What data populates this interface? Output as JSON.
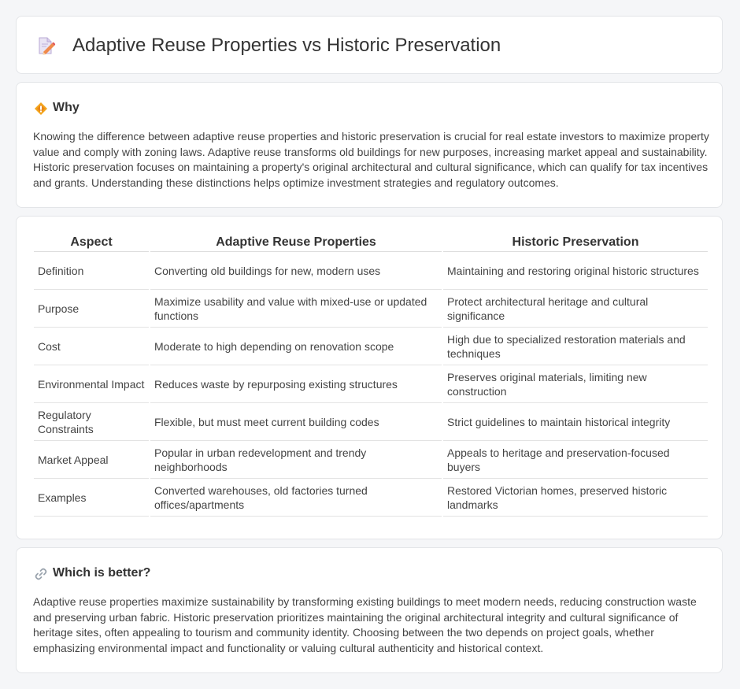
{
  "header": {
    "title": "Adaptive Reuse Properties vs Historic Preservation",
    "icon": "document-pencil-icon"
  },
  "why": {
    "heading": "Why",
    "icon": "diamond-warning-icon",
    "text": "Knowing the difference between adaptive reuse properties and historic preservation is crucial for real estate investors to maximize property value and comply with zoning laws. Adaptive reuse transforms old buildings for new purposes, increasing market appeal and sustainability. Historic preservation focuses on maintaining a property's original architectural and cultural significance, which can qualify for tax incentives and grants. Understanding these distinctions helps optimize investment strategies and regulatory outcomes."
  },
  "table": {
    "headers": [
      "Aspect",
      "Adaptive Reuse Properties",
      "Historic Preservation"
    ],
    "rows": [
      [
        "Definition",
        "Converting old buildings for new, modern uses",
        "Maintaining and restoring original historic structures"
      ],
      [
        "Purpose",
        "Maximize usability and value with mixed-use or updated functions",
        "Protect architectural heritage and cultural significance"
      ],
      [
        "Cost",
        "Moderate to high depending on renovation scope",
        "High due to specialized restoration materials and techniques"
      ],
      [
        "Environmental Impact",
        "Reduces waste by repurposing existing structures",
        "Preserves original materials, limiting new construction"
      ],
      [
        "Regulatory Constraints",
        "Flexible, but must meet current building codes",
        "Strict guidelines to maintain historical integrity"
      ],
      [
        "Market Appeal",
        "Popular in urban redevelopment and trendy neighborhoods",
        "Appeals to heritage and preservation-focused buyers"
      ],
      [
        "Examples",
        "Converted warehouses, old factories turned offices/apartments",
        "Restored Victorian homes, preserved historic landmarks"
      ]
    ]
  },
  "better": {
    "heading": "Which is better?",
    "icon": "link-icon",
    "text": "Adaptive reuse properties maximize sustainability by transforming existing buildings to meet modern needs, reducing construction waste and preserving urban fabric. Historic preservation prioritizes maintaining the original architectural integrity and cultural significance of heritage sites, often appealing to tourism and community identity. Choosing between the two depends on project goals, whether emphasizing environmental impact and functionality or valuing cultural authenticity and historical context."
  }
}
